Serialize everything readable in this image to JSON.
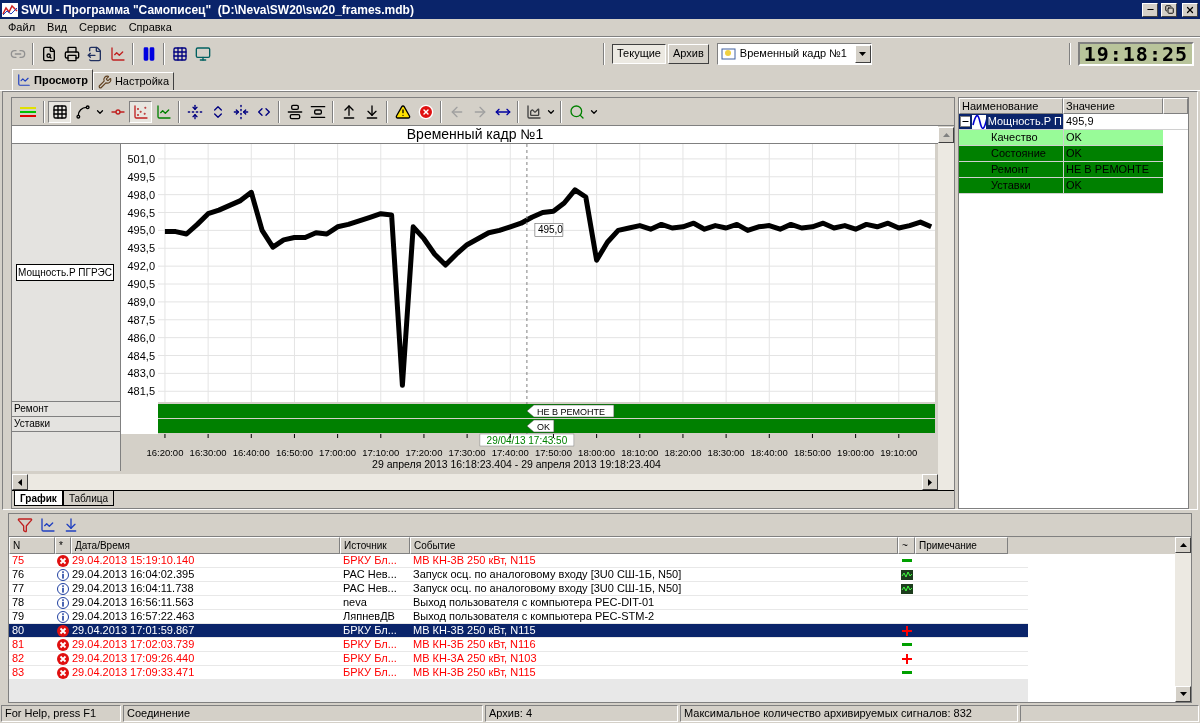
{
  "window": {
    "title": "SWUI - Программа \"Самописец\"  (D:\\Neva\\SW20\\sw20_frames.mdb)"
  },
  "menu": [
    "Файл",
    "Вид",
    "Сервис",
    "Справка"
  ],
  "toolbar": {
    "mode_buttons": [
      {
        "label": "Текущие",
        "selected": true
      },
      {
        "label": "Архив",
        "selected": false
      }
    ],
    "frame_select": {
      "value": "Временный кадр №1"
    },
    "clock": "19:18:25"
  },
  "tabs": [
    {
      "label": "Просмотр",
      "selected": true
    },
    {
      "label": "Настройка",
      "selected": false
    }
  ],
  "chart": {
    "title": "Временный кадр №1",
    "bands": [
      {
        "name": "Ремонт",
        "state": "НЕ В РЕМОНТЕ",
        "color": "#008000"
      },
      {
        "name": "Уставки",
        "state": "OK",
        "color": "#008000"
      }
    ],
    "chart_data": {
      "type": "line",
      "xlabel": "29 апреля 2013 16:18:23.404 - 29 апреля 2013 19:18:23.404",
      "categories": [
        "16:20:00",
        null,
        null,
        null,
        "16:30:00",
        null,
        null,
        null,
        "16:40:00",
        null,
        null,
        null,
        "16:50:00",
        null,
        null,
        null,
        "17:00:00",
        null,
        null,
        null,
        "17:10:00",
        null,
        null,
        null,
        "17:20:00",
        null,
        null,
        null,
        "17:30:00",
        null,
        null,
        null,
        "17:40:00",
        null,
        null,
        null,
        "17:50:00",
        null,
        null,
        null,
        "18:00:00",
        null,
        null,
        null,
        "18:10:00",
        null,
        null,
        null,
        "18:20:00",
        null,
        null,
        null,
        "18:30:00",
        null,
        null,
        null,
        "18:40:00",
        null,
        null,
        null,
        "18:50:00",
        null,
        null,
        null,
        "19:00:00",
        null,
        null,
        null,
        "19:10:00",
        null,
        null,
        null
      ],
      "series": [
        {
          "name": "Мощность.Р ПГРЭС",
          "color": "#000000",
          "values": [
            494.9,
            494.9,
            494.7,
            495.5,
            496.4,
            496.7,
            497.1,
            497.5,
            498.2,
            495.0,
            493.6,
            494.2,
            494.4,
            494.4,
            494.8,
            494.7,
            495.3,
            495.5,
            495.8,
            496.1,
            496.4,
            496.3,
            482.0,
            495.3,
            494.3,
            493.0,
            492.1,
            493.0,
            493.8,
            494.3,
            494.8,
            495.0,
            495.3,
            495.6,
            496.1,
            496.5,
            496.6,
            497.3,
            498.4,
            497.8,
            492.5,
            494.0,
            495.0,
            495.2,
            495.4,
            495.1,
            495.5,
            495.2,
            495.3,
            495.6,
            495.1,
            495.4,
            495.2,
            495.5,
            495.0,
            495.3,
            495.4,
            495.1,
            495.5,
            495.2,
            495.3,
            495.6,
            495.2,
            495.4,
            495.1,
            495.5,
            495.3,
            495.6,
            495.2,
            495.4,
            495.7,
            495.3
          ]
        }
      ],
      "ylim": [
        480.6,
        502.25
      ],
      "yticks": [
        {
          "value": 501,
          "label": "501,0"
        },
        {
          "value": 499.5,
          "label": "499,5"
        },
        {
          "value": 498,
          "label": "498,0"
        },
        {
          "value": 496.5,
          "label": "496,5"
        },
        {
          "value": 495,
          "label": "495,0"
        },
        {
          "value": 493.5,
          "label": "493,5"
        },
        {
          "value": 492,
          "label": "492,0"
        },
        {
          "value": 490.5,
          "label": "490,5"
        },
        {
          "value": 489,
          "label": "489,0"
        },
        {
          "value": 487.5,
          "label": "487,5"
        },
        {
          "value": 486,
          "label": "486,0"
        },
        {
          "value": 484.5,
          "label": "484,5"
        },
        {
          "value": 483,
          "label": "483,0"
        },
        {
          "value": 481.5,
          "label": "481,5"
        }
      ],
      "grid": true,
      "annotations": [
        "29/04/13 17:43:50",
        "495,0"
      ]
    }
  },
  "view_tabs": [
    {
      "label": "График",
      "selected": true
    },
    {
      "label": "Таблица",
      "selected": false
    }
  ],
  "signals": {
    "columns": [
      "Наименование",
      "Значение"
    ],
    "rows": [
      {
        "name": "Мощность.Р П",
        "value": "495,9",
        "expanded": true,
        "selected": true,
        "children": [
          {
            "name": "Качество",
            "value": "OK",
            "color": "#98fb98"
          },
          {
            "name": "Состояние",
            "value": "OK",
            "color": "#008000"
          },
          {
            "name": "Ремонт",
            "value": "НЕ В РЕМОНТЕ",
            "color": "#008000"
          },
          {
            "name": "Уставки",
            "value": "OK",
            "color": "#008000"
          }
        ]
      }
    ]
  },
  "events": {
    "columns": [
      "N",
      "*",
      "Дата/Время",
      "Источник",
      "Событие",
      "~",
      "Примечание"
    ],
    "rows": [
      {
        "n": "75",
        "kind": "error",
        "datetime": "29.04.2013 15:19:10.140",
        "source": "БРКУ Бл...",
        "event": "МВ КН-3В 250 кВт, N115",
        "marker": {
          "kind": "minus"
        },
        "selected": false
      },
      {
        "n": "76",
        "kind": "info",
        "datetime": "29.04.2013 16:04:02.395",
        "source": "РАС Нев...",
        "event": "Запуск осц. по аналоговому входу [3U0 СШ-1Б, N50]",
        "marker": {
          "kind": "oscillogram"
        },
        "selected": false
      },
      {
        "n": "77",
        "kind": "info",
        "datetime": "29.04.2013 16:04:11.738",
        "source": "РАС Нев...",
        "event": "Запуск осц. по аналоговому входу [3U0 СШ-1Б, N50]",
        "marker": {
          "kind": "oscillogram"
        },
        "selected": false
      },
      {
        "n": "78",
        "kind": "info",
        "datetime": "29.04.2013 16:56:11.563",
        "source": "neva",
        "event": "Выход пользователя с компьютера PEC-DIT-01",
        "selected": false
      },
      {
        "n": "79",
        "kind": "info",
        "datetime": "29.04.2013 16:57:22.463",
        "source": "ЛяпневДВ",
        "event": "Выход пользователя с компьютера PEC-STM-2",
        "selected": false
      },
      {
        "n": "80",
        "kind": "error",
        "datetime": "29.04.2013 17:01:59.867",
        "source": "БРКУ Бл...",
        "event": "МВ КН-3В 250 кВт, N115",
        "marker": {
          "kind": "plus"
        },
        "selected": true
      },
      {
        "n": "81",
        "kind": "error",
        "datetime": "29.04.2013 17:02:03.739",
        "source": "БРКУ Бл...",
        "event": "МВ КН-3Б 250 кВт, N116",
        "marker": {
          "kind": "minus"
        },
        "selected": false
      },
      {
        "n": "82",
        "kind": "error",
        "datetime": "29.04.2013 17:09:26.440",
        "source": "БРКУ Бл...",
        "event": "МВ КН-3А 250 кВт, N103",
        "marker": {
          "kind": "plus"
        },
        "selected": false
      },
      {
        "n": "83",
        "kind": "error",
        "datetime": "29.04.2013 17:09:33.471",
        "source": "БРКУ Бл...",
        "event": "МВ КН-3В 250 кВт, N115",
        "marker": {
          "kind": "minus"
        },
        "selected": false
      }
    ]
  },
  "status_bar": [
    "For Help, press F1",
    "Соединение",
    "Архив: 4",
    "Максимальное количество архивируемых сигналов: 832"
  ]
}
